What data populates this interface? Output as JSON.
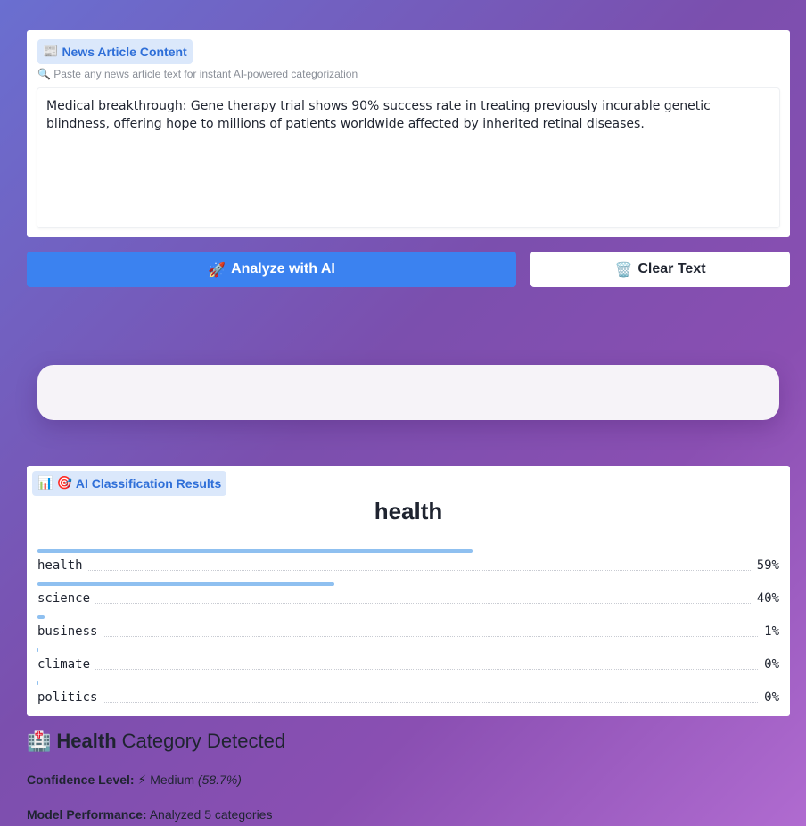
{
  "input": {
    "chip_icon": "📰",
    "chip_label": "News Article Content",
    "hint_icon": "🔍",
    "hint_text": "Paste any news article text for instant AI-powered categorization",
    "article_text": "Medical breakthrough: Gene therapy trial shows 90% success rate in treating previously incurable genetic blindness, offering hope to millions of patients worldwide affected by inherited retinal diseases."
  },
  "buttons": {
    "analyze_icon": "🚀",
    "analyze_label": "Analyze with AI",
    "clear_icon": "🗑️",
    "clear_label": "Clear Text"
  },
  "results": {
    "chip_icon": "📊",
    "chip_icon2": "🎯",
    "chip_label": "AI Classification Results",
    "top_label": "health",
    "rows": [
      {
        "label": "health",
        "pct": "59%",
        "value": 0.587
      },
      {
        "label": "science",
        "pct": "40%",
        "value": 0.4
      },
      {
        "label": "business",
        "pct": "1%",
        "value": 0.01
      },
      {
        "label": "climate",
        "pct": "0%",
        "value": 0.0
      },
      {
        "label": "politics",
        "pct": "0%",
        "value": 0.0
      }
    ]
  },
  "summary": {
    "heading_icon": "🏥",
    "heading_strong": "Health",
    "heading_rest": "Category Detected",
    "confidence_key": "Confidence Level:",
    "confidence_icon": "⚡",
    "confidence_value": "Medium",
    "confidence_pct": "(58.7%)",
    "performance_key": "Model Performance:",
    "performance_value": "Analyzed 5 categories"
  },
  "colors": {
    "accent": "#3b82f0",
    "bar": "#8fc0f0",
    "chip_bg": "#dbe8fb",
    "chip_text": "#2f6fd8"
  }
}
